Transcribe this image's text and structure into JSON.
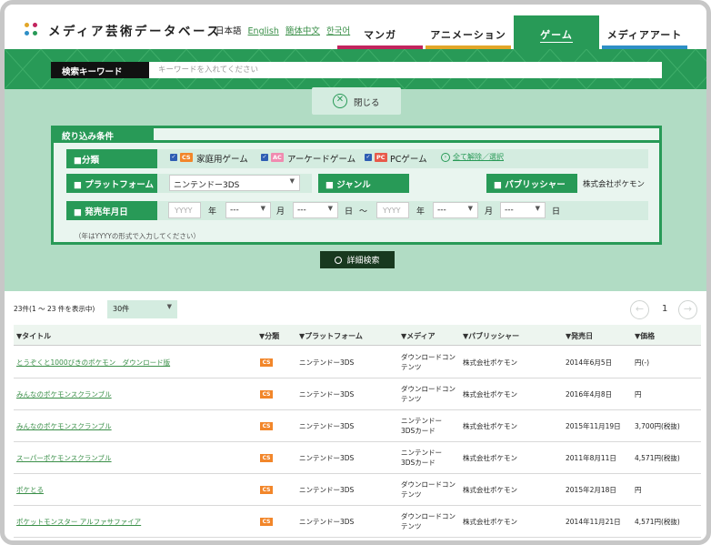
{
  "header": {
    "site_title": "メディア芸術データベース",
    "languages": [
      {
        "label": "日本語",
        "current": true
      },
      {
        "label": "English",
        "current": false
      },
      {
        "label": "簡体中文",
        "current": false
      },
      {
        "label": "한국어",
        "current": false
      }
    ],
    "tabs": [
      {
        "label": "マンガ",
        "color": "#c2245e",
        "active": false
      },
      {
        "label": "アニメーション",
        "color": "#e2a628",
        "active": false
      },
      {
        "label": "ゲーム",
        "color": "#289a57",
        "active": true
      },
      {
        "label": "メディアアート",
        "color": "#2e8fc6",
        "active": false
      }
    ]
  },
  "keyword": {
    "label": "検索キーワード",
    "placeholder": "キーワードを入れてください",
    "value": ""
  },
  "close_button": {
    "label": "閉じる"
  },
  "filters": {
    "title": "絞り込み条件",
    "category": {
      "label": "■分類",
      "options": [
        {
          "tag": "CS",
          "label": "家庭用ゲーム",
          "checked": true,
          "tag_color": "#f2862a"
        },
        {
          "tag": "AC",
          "label": "アーケードゲーム",
          "checked": true,
          "tag_color": "#f08bb0"
        },
        {
          "tag": "PC",
          "label": "PCゲーム",
          "checked": true,
          "tag_color": "#e85a4a"
        }
      ],
      "select_all": "全て解除／選択"
    },
    "platform": {
      "label": "■ プラットフォーム",
      "value": "ニンテンドー3DS"
    },
    "genre": {
      "label": "■ ジャンル",
      "value": ""
    },
    "publisher": {
      "label": "■ パブリッシャー",
      "value": "株式会社ポケモン"
    },
    "release": {
      "label": "■ 発売年月日",
      "year_placeholder": "YYYY",
      "select_placeholder": "---",
      "unit_year": "年",
      "unit_month": "月",
      "unit_day": "日",
      "range_sep": "〜",
      "note": "（年はYYYYの形式で入力してください）"
    },
    "search_button": "詳細検索"
  },
  "results": {
    "count_text": "23件(1 〜 23 件を表示中)",
    "per_page": "30件",
    "page": "1",
    "columns": [
      "▼タイトル",
      "▼分類",
      "▼プラットフォーム",
      "▼メディア",
      "▼パブリッシャー",
      "▼発売日",
      "▼価格"
    ],
    "rows": [
      {
        "title": "とうぞくと1000びきのポケモン　ダウンロード版",
        "category": "CS",
        "platform": "ニンテンドー3DS",
        "media1": "ダウンロードコン",
        "media2": "テンツ",
        "publisher": "株式会社ポケモン",
        "date": "2014年6月5日",
        "price": "円(-)"
      },
      {
        "title": "みんなのポケモンスクランブル",
        "category": "CS",
        "platform": "ニンテンドー3DS",
        "media1": "ダウンロードコン",
        "media2": "テンツ",
        "publisher": "株式会社ポケモン",
        "date": "2016年4月8日",
        "price": "円"
      },
      {
        "title": "みんなのポケモンスクランブル",
        "category": "CS",
        "platform": "ニンテンドー3DS",
        "media1": "ニンテンドー",
        "media2": "3DSカード",
        "publisher": "株式会社ポケモン",
        "date": "2015年11月19日",
        "price": "3,700円(税抜)"
      },
      {
        "title": "スーパーポケモンスクランブル",
        "category": "CS",
        "platform": "ニンテンドー3DS",
        "media1": "ニンテンドー",
        "media2": "3DSカード",
        "publisher": "株式会社ポケモン",
        "date": "2011年8月11日",
        "price": "4,571円(税抜)"
      },
      {
        "title": "ポケとる",
        "category": "CS",
        "platform": "ニンテンドー3DS",
        "media1": "ダウンロードコン",
        "media2": "テンツ",
        "publisher": "株式会社ポケモン",
        "date": "2015年2月18日",
        "price": "円"
      },
      {
        "title": "ポケットモンスター アルファサファイア",
        "category": "CS",
        "platform": "ニンテンドー3DS",
        "media1": "ダウンロードコン",
        "media2": "テンツ",
        "publisher": "株式会社ポケモン",
        "date": "2014年11月21日",
        "price": "4,571円(税抜)"
      }
    ]
  }
}
